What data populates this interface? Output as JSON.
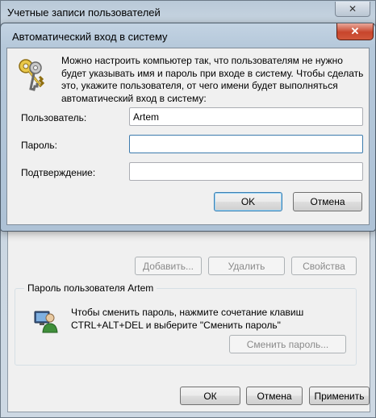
{
  "background_window": {
    "title": "Учетные записи пользователей",
    "close_glyph": "✕",
    "buttons": {
      "add": "Добавить...",
      "remove": "Удалить",
      "properties": "Свойства"
    },
    "password_group": {
      "legend": "Пароль пользователя Artem",
      "text": "Чтобы сменить пароль, нажмите сочетание клавиш CTRL+ALT+DEL и выберите \"Сменить пароль\"",
      "change_button": "Сменить пароль...",
      "icon": "user-icon"
    },
    "footer": {
      "ok": "ОК",
      "cancel": "Отмена",
      "apply": "Применить"
    }
  },
  "dialog": {
    "title": "Автоматический вход в систему",
    "close_glyph": "✕",
    "icon": "keys-icon",
    "description": "Можно настроить компьютер так, что пользователям не нужно будет указывать имя и пароль при входе в систему. Чтобы сделать это, укажите пользователя, от чего имени будет выполняться автоматический вход в систему:",
    "fields": {
      "user_label": "Пользователь:",
      "user_value": "Artem",
      "password_label": "Пароль:",
      "password_value": "",
      "confirm_label": "Подтверждение:",
      "confirm_value": ""
    },
    "ok": "OK",
    "cancel": "Отмена"
  }
}
